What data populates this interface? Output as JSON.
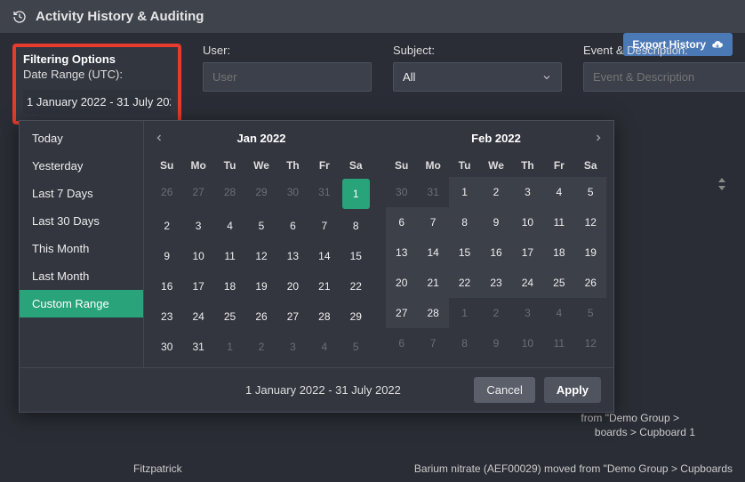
{
  "header": {
    "title": "Activity History & Auditing"
  },
  "filter": {
    "heading": "Filtering Options",
    "sub": "Date Range (UTC):",
    "date_value": "1 January 2022 - 31 July 202",
    "user_label": "User:",
    "user_placeholder": "User",
    "subject_label": "Subject:",
    "subject_value": "All",
    "event_label": "Event & Description:",
    "event_placeholder": "Event & Description"
  },
  "export_label": "Export History",
  "ranges": {
    "items": [
      "Today",
      "Yesterday",
      "Last 7 Days",
      "Last 30 Days",
      "This Month",
      "Last Month",
      "Custom Range"
    ],
    "active_index": 6
  },
  "datepicker": {
    "cal1": {
      "title": "Jan 2022",
      "weekdays": [
        "Su",
        "Mo",
        "Tu",
        "We",
        "Th",
        "Fr",
        "Sa"
      ],
      "rows": [
        [
          {
            "n": "26",
            "m": true
          },
          {
            "n": "27",
            "m": true
          },
          {
            "n": "28",
            "m": true
          },
          {
            "n": "29",
            "m": true
          },
          {
            "n": "30",
            "m": true
          },
          {
            "n": "31",
            "m": true
          },
          {
            "n": "1",
            "start": true
          }
        ],
        [
          {
            "n": "2"
          },
          {
            "n": "3"
          },
          {
            "n": "4"
          },
          {
            "n": "5"
          },
          {
            "n": "6"
          },
          {
            "n": "7"
          },
          {
            "n": "8"
          }
        ],
        [
          {
            "n": "9"
          },
          {
            "n": "10"
          },
          {
            "n": "11"
          },
          {
            "n": "12"
          },
          {
            "n": "13"
          },
          {
            "n": "14"
          },
          {
            "n": "15"
          }
        ],
        [
          {
            "n": "16"
          },
          {
            "n": "17"
          },
          {
            "n": "18"
          },
          {
            "n": "19"
          },
          {
            "n": "20"
          },
          {
            "n": "21"
          },
          {
            "n": "22"
          }
        ],
        [
          {
            "n": "23"
          },
          {
            "n": "24"
          },
          {
            "n": "25"
          },
          {
            "n": "26"
          },
          {
            "n": "27"
          },
          {
            "n": "28"
          },
          {
            "n": "29"
          }
        ],
        [
          {
            "n": "30"
          },
          {
            "n": "31"
          },
          {
            "n": "1",
            "m": true
          },
          {
            "n": "2",
            "m": true
          },
          {
            "n": "3",
            "m": true
          },
          {
            "n": "4",
            "m": true
          },
          {
            "n": "5",
            "m": true
          }
        ]
      ]
    },
    "cal2": {
      "title": "Feb 2022",
      "weekdays": [
        "Su",
        "Mo",
        "Tu",
        "We",
        "Th",
        "Fr",
        "Sa"
      ],
      "rows": [
        [
          {
            "n": "30",
            "m": true
          },
          {
            "n": "31",
            "m": true
          },
          {
            "n": "1",
            "r": true
          },
          {
            "n": "2",
            "r": true
          },
          {
            "n": "3",
            "r": true
          },
          {
            "n": "4",
            "r": true
          },
          {
            "n": "5",
            "r": true
          }
        ],
        [
          {
            "n": "6",
            "r": true
          },
          {
            "n": "7",
            "r": true
          },
          {
            "n": "8",
            "r": true
          },
          {
            "n": "9",
            "r": true
          },
          {
            "n": "10",
            "r": true
          },
          {
            "n": "11",
            "r": true
          },
          {
            "n": "12",
            "r": true
          }
        ],
        [
          {
            "n": "13",
            "r": true
          },
          {
            "n": "14",
            "r": true
          },
          {
            "n": "15",
            "r": true
          },
          {
            "n": "16",
            "r": true
          },
          {
            "n": "17",
            "r": true
          },
          {
            "n": "18",
            "r": true
          },
          {
            "n": "19",
            "r": true
          }
        ],
        [
          {
            "n": "20",
            "r": true
          },
          {
            "n": "21",
            "r": true
          },
          {
            "n": "22",
            "r": true
          },
          {
            "n": "23",
            "r": true
          },
          {
            "n": "24",
            "r": true
          },
          {
            "n": "25",
            "r": true
          },
          {
            "n": "26",
            "r": true
          }
        ],
        [
          {
            "n": "27",
            "r": true
          },
          {
            "n": "28",
            "r": true
          },
          {
            "n": "1",
            "m": true
          },
          {
            "n": "2",
            "m": true
          },
          {
            "n": "3",
            "m": true
          },
          {
            "n": "4",
            "m": true
          },
          {
            "n": "5",
            "m": true
          }
        ],
        [
          {
            "n": "6",
            "m": true
          },
          {
            "n": "7",
            "m": true
          },
          {
            "n": "8",
            "m": true
          },
          {
            "n": "9",
            "m": true
          },
          {
            "n": "10",
            "m": true
          },
          {
            "n": "11",
            "m": true
          },
          {
            "n": "12",
            "m": true
          }
        ]
      ]
    },
    "footer_text": "1 January 2022 - 31 July 2022",
    "cancel": "Cancel",
    "apply": "Apply"
  },
  "bg_log": {
    "line1": "from \"Demo Group >",
    "line2": "boards > Cupboard 1",
    "line3_left": "Fitzpatrick",
    "line3_right": "Barium nitrate (AEF00029) moved from \"Demo Group > Cupboards"
  }
}
